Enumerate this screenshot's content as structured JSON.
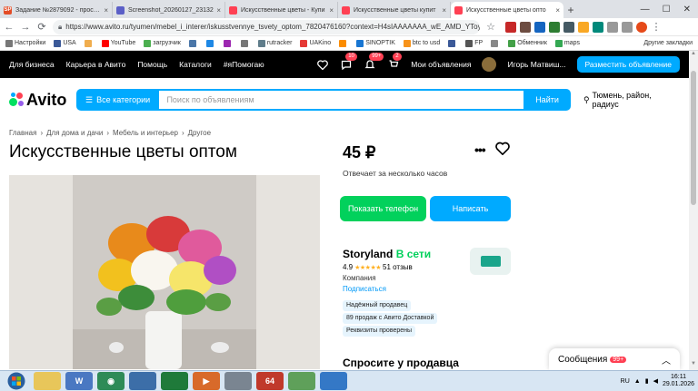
{
  "browser": {
    "tabs": [
      {
        "title": "Задание №2879092 - просмо",
        "fav_color": "#e34c26",
        "fav_text": "SP",
        "active": false
      },
      {
        "title": "Screenshot_20260127_23132",
        "fav_color": "#5b5fc7",
        "fav_text": "",
        "active": false
      },
      {
        "title": "Искусственные цветы - Купи",
        "fav_color": "#ff4053",
        "fav_text": "",
        "active": false
      },
      {
        "title": "Искусственные цветы купит",
        "fav_color": "#ff4053",
        "fav_text": "",
        "active": false
      },
      {
        "title": "Искусственные цветы опто",
        "fav_color": "#ff4053",
        "fav_text": "",
        "active": true
      }
    ],
    "new_tab": "+",
    "url": "https://www.avito.ru/tyumen/mebel_i_interer/iskusstvennye_tsvety_optom_7820476160?context=H4sIAAAAAAA_wE_AMD_YToyO...",
    "bookmarks": [
      {
        "label": "Настройки",
        "color": "#777"
      },
      {
        "label": "USA",
        "color": "#3b5998"
      },
      {
        "label": "",
        "color": "#f0ad4e"
      },
      {
        "label": "YouTube",
        "color": "#ff0000"
      },
      {
        "label": "загрузчик",
        "color": "#4caf50"
      },
      {
        "label": "",
        "color": "#4a76a8"
      },
      {
        "label": "",
        "color": "#1e88e5"
      },
      {
        "label": "",
        "color": "#9c27b0"
      },
      {
        "label": "",
        "color": "#777"
      },
      {
        "label": "rutracker",
        "color": "#607d8b"
      },
      {
        "label": "UAKino",
        "color": "#e53935"
      },
      {
        "label": "",
        "color": "#fb8c00"
      },
      {
        "label": "SINOPTIK",
        "color": "#1976d2"
      },
      {
        "label": "btc to usd",
        "color": "#f7931a"
      },
      {
        "label": "",
        "color": "#3b5998"
      },
      {
        "label": "FP",
        "color": "#555"
      },
      {
        "label": "",
        "color": "#888"
      },
      {
        "label": "Обменник",
        "color": "#43a047"
      },
      {
        "label": "maps",
        "color": "#34a853"
      }
    ],
    "other_bookmarks": "Другие закладки"
  },
  "avito": {
    "top_links": [
      "Для бизнеса",
      "Карьера в Авито",
      "Помощь",
      "Каталоги",
      "#яПомогаю"
    ],
    "badges": {
      "messages": "10",
      "notifications": "99+",
      "cart": "2"
    },
    "my_ads": "Мои объявления",
    "user_name": "Игорь Матвиш...",
    "place_ad": "Разместить объявление",
    "logo_text": "Avito",
    "all_categories": "Все категории",
    "search_placeholder": "Поиск по объявлениям",
    "search_button": "Найти",
    "location": "Тюмень, район, радиус"
  },
  "listing": {
    "breadcrumbs": [
      "Главная",
      "Для дома и дачи",
      "Мебель и интерьер",
      "Другое"
    ],
    "title": "Искусственные цветы оптом",
    "price": "45 ₽",
    "responds": "Отвечает за несколько часов",
    "show_phone": "Показать телефон",
    "write": "Написать",
    "seller_name": "Storyland",
    "seller_status": "В сети",
    "rating": "4.9",
    "stars": "★★★★★",
    "reviews": "51 отзыв",
    "seller_type": "Компания",
    "subscribe": "Подписаться",
    "chips": [
      "Надёжный продавец",
      "89 продаж с Авито Доставкой",
      "Реквизиты проверены"
    ],
    "ask_title": "Спросите у продавца"
  },
  "messages": {
    "label": "Сообщения",
    "count": "99+"
  },
  "taskbar": {
    "lang": "RU",
    "time": "16:11",
    "date": "29.01.2026"
  }
}
